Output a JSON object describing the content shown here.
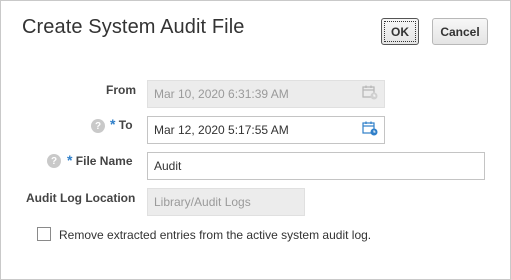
{
  "dialog": {
    "title": "Create System Audit File",
    "ok_label": "OK",
    "cancel_label": "Cancel"
  },
  "form": {
    "from": {
      "label": "From",
      "value": "Mar 10, 2020 6:31:39 AM"
    },
    "to": {
      "required_mark": "*",
      "label": "To",
      "value": "Mar 12, 2020 5:17:55 AM"
    },
    "file_name": {
      "required_mark": "*",
      "label": "File Name",
      "value": "Audit"
    },
    "audit_log_location": {
      "label": "Audit Log Location",
      "value": "Library/Audit Logs"
    },
    "remove_entries": {
      "label": "Remove extracted entries from the active system audit log.",
      "checked": false
    }
  },
  "icons": {
    "help": "help-icon",
    "calendar": "calendar-icon"
  },
  "colors": {
    "required": "#2f7fc9",
    "calendar_accent": "#2f7fc9"
  }
}
